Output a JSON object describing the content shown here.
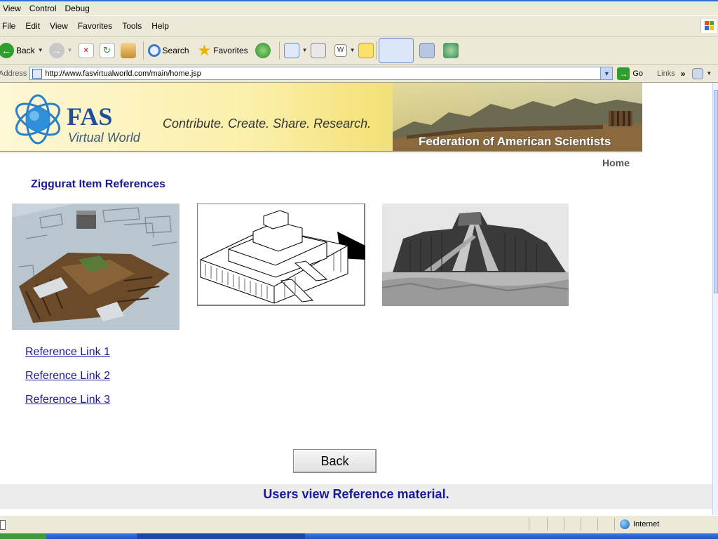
{
  "app_menu": [
    "View",
    "Control",
    "Debug"
  ],
  "ie_menu": [
    "File",
    "Edit",
    "View",
    "Favorites",
    "Tools",
    "Help"
  ],
  "toolbar": {
    "back_label": "Back",
    "search_label": "Search",
    "favorites_label": "Favorites"
  },
  "address": {
    "label": "Address",
    "url": "http://www.fasvirtualworld.com/main/home.jsp",
    "go_label": "Go",
    "links_label": "Links"
  },
  "banner": {
    "logo_title": "FAS",
    "logo_subtitle": "Virtual World",
    "slogan": "Contribute. Create. Share. Research.",
    "organization": "Federation of American Scientists"
  },
  "nav": {
    "home_label": "Home"
  },
  "content": {
    "section_title": "Ziggurat Item References",
    "images": [
      {
        "name": "ziggurat-3d-model"
      },
      {
        "name": "ziggurat-line-drawing"
      },
      {
        "name": "ziggurat-photograph"
      }
    ],
    "links": [
      "Reference Link 1",
      "Reference Link 2",
      "Reference Link 3"
    ],
    "back_button": "Back"
  },
  "caption": "Users view Reference material.",
  "status": {
    "zone_label": "Internet"
  },
  "colors": {
    "link_blue": "#1a1a99",
    "fas_blue": "#1d4f9a",
    "chrome_beige": "#ece9d8"
  }
}
